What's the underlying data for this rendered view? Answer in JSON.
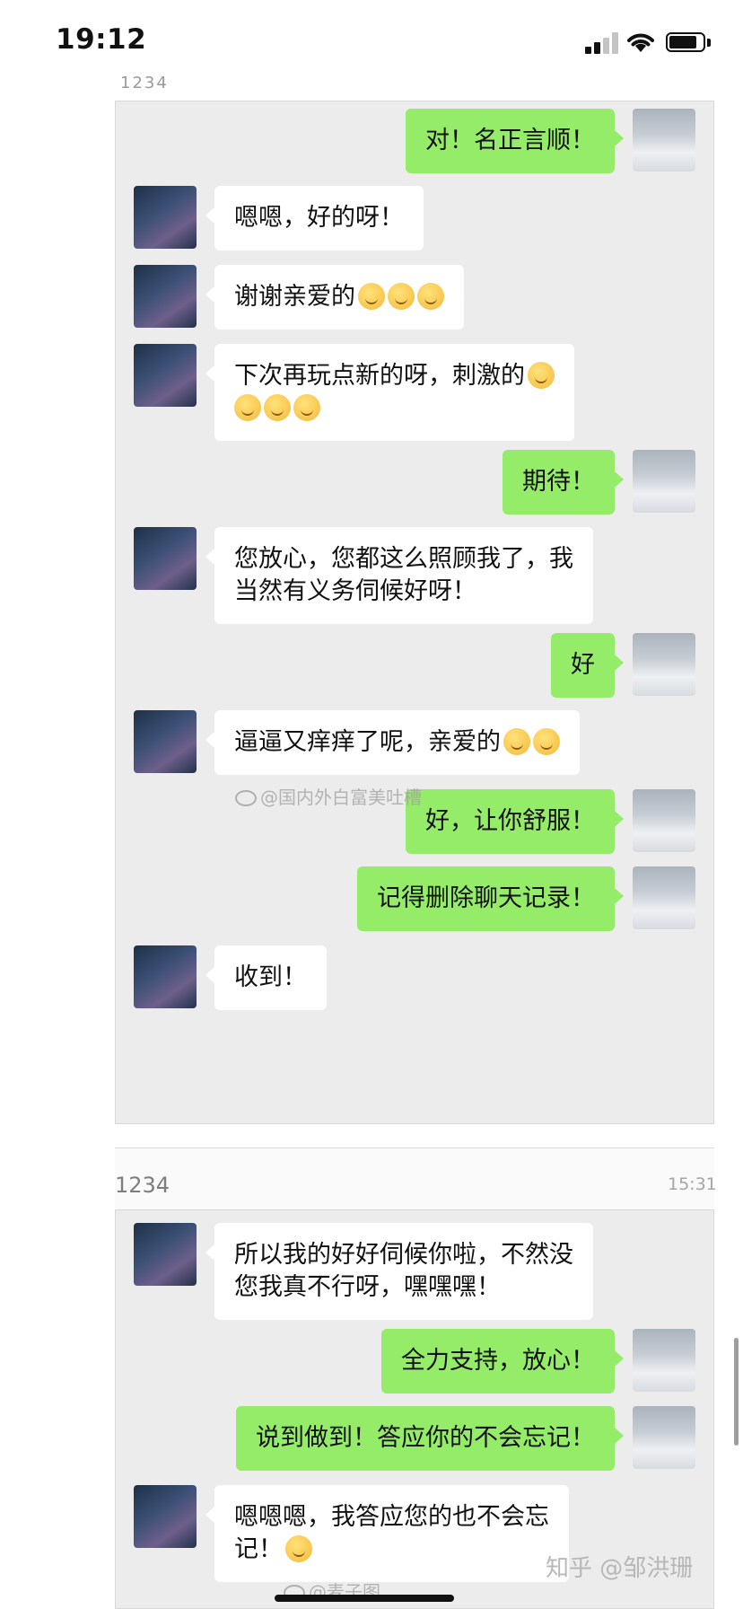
{
  "status_bar": {
    "time": "19:12"
  },
  "top_cut_text": "1234",
  "panel1_messages": [
    {
      "side": "out",
      "text": "对！名正言顺！",
      "emoji": 0
    },
    {
      "side": "in",
      "text": "嗯嗯，好的呀！",
      "emoji": 0
    },
    {
      "side": "in",
      "text": "谢谢亲爱的",
      "emoji": 3
    },
    {
      "side": "in",
      "lines": [
        "下次再玩点新的呀，刺激的",
        ""
      ],
      "emoji_line1": 1,
      "emoji_line2": 3
    },
    {
      "side": "out",
      "text": "期待！",
      "emoji": 0
    },
    {
      "side": "in",
      "lines": [
        "您放心，您都这么照顾我了，我",
        "当然有义务伺候好呀！"
      ]
    },
    {
      "side": "out",
      "text": "好",
      "emoji": 0
    },
    {
      "side": "in",
      "text": "逼逼又痒痒了呢，亲爱的",
      "emoji": 2
    },
    {
      "side": "out",
      "text": "好，让你舒服！",
      "emoji": 0
    },
    {
      "side": "out",
      "text": "记得删除聊天记录！",
      "emoji": 0
    },
    {
      "side": "in",
      "text": "收到！",
      "emoji": 0
    }
  ],
  "chat_header": {
    "title": "1234",
    "time": "15:31"
  },
  "panel2_messages": [
    {
      "side": "in",
      "lines": [
        "所以我的好好伺候你啦，不然没",
        "您我真不行呀，嘿嘿嘿！"
      ]
    },
    {
      "side": "out",
      "text": "全力支持，放心！"
    },
    {
      "side": "out",
      "text": "说到做到！答应你的不会忘记！"
    },
    {
      "side": "in",
      "lines": [
        "嗯嗯嗯，我答应您的也不会忘",
        "记！"
      ]
    }
  ],
  "watermarks": {
    "weibo1": "@国内外白富美吐槽",
    "weibo2": "@麦子图",
    "zhihu": "知乎 @邹洪珊"
  },
  "colors": {
    "bubble_out": "#95ec69",
    "bubble_in": "#ffffff",
    "chat_bg": "#ececec"
  }
}
